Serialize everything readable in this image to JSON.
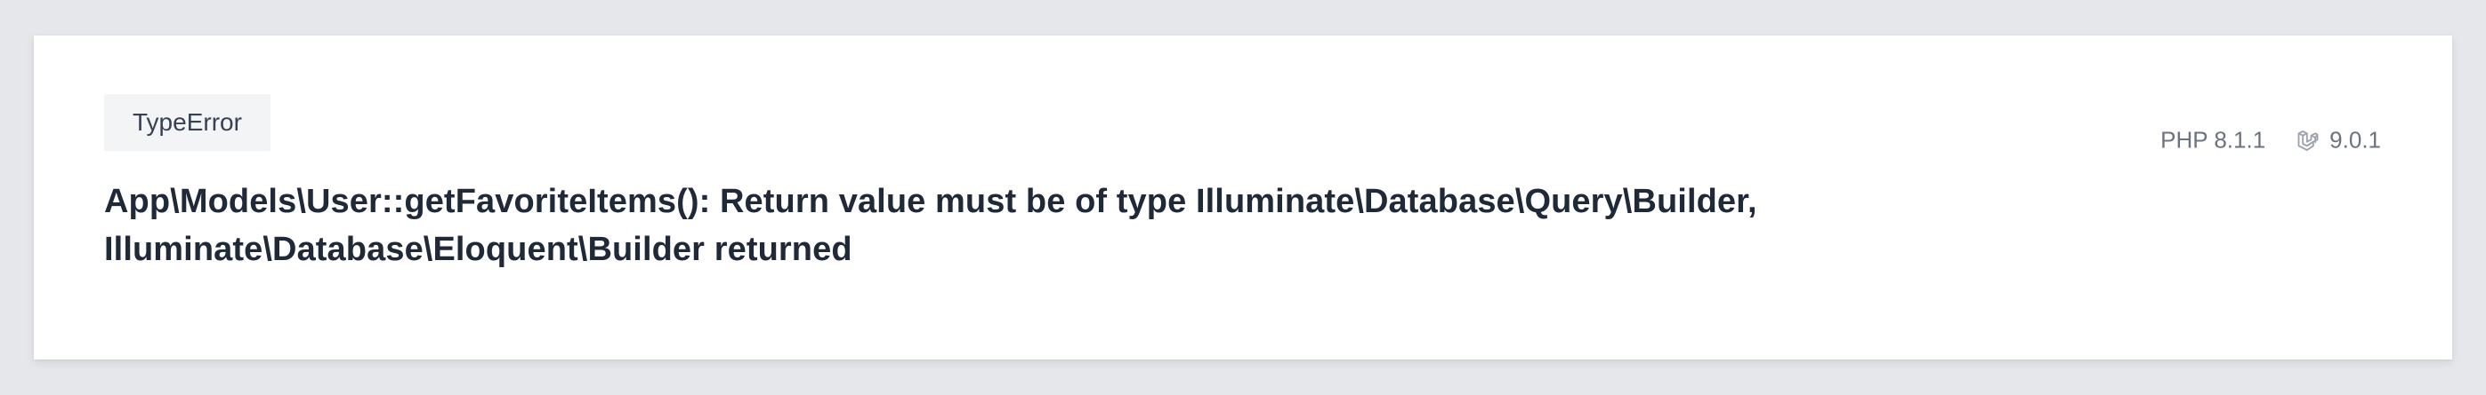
{
  "exception": {
    "type": "TypeError",
    "message": "App\\Models\\User::getFavoriteItems(): Return value must be of type Illuminate\\Database\\Query\\Builder, Illuminate\\Database\\Eloquent\\Builder returned"
  },
  "environment": {
    "php_version": "PHP 8.1.1",
    "laravel_version": "9.0.1",
    "laravel_icon": "laravel-logo-icon"
  }
}
